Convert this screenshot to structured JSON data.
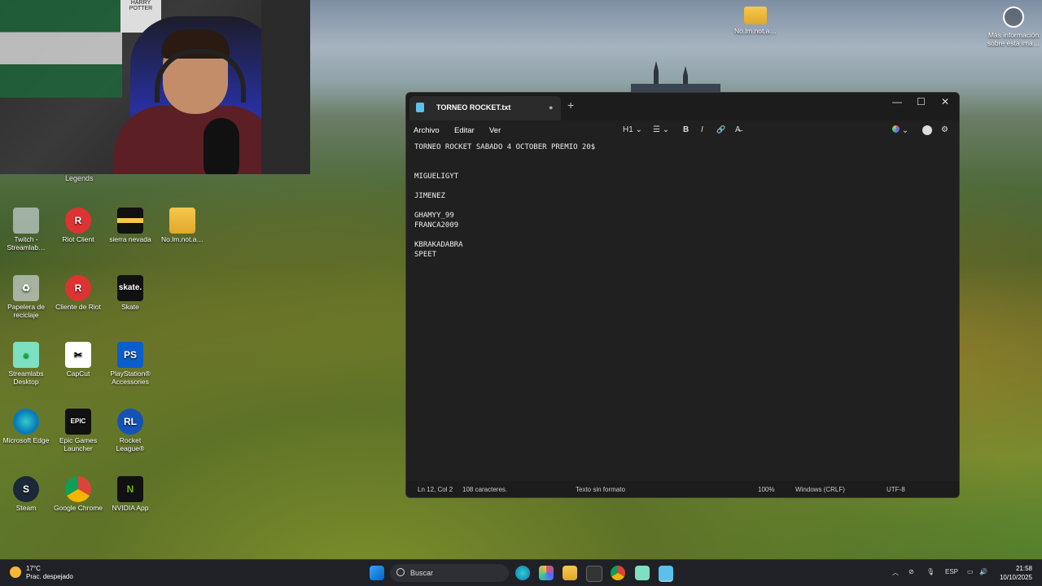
{
  "desktop": {
    "webcam_label": "Legends",
    "poster_text": "HARRY POTTER",
    "icons": [
      {
        "label": "Twitch - Streamlab…",
        "glyph": "",
        "class": "recycle",
        "icon": "twitch-icon"
      },
      {
        "label": "Riot Client",
        "glyph": "R",
        "class": "riot",
        "icon": "riot-client-icon"
      },
      {
        "label": "sierra nevada",
        "glyph": "",
        "class": "blackf",
        "icon": "folder-icon"
      },
      {
        "label": "No.lm.not.a…",
        "glyph": "",
        "class": "folder",
        "icon": "folder-icon"
      },
      {
        "label": "Papelera de reciclaje",
        "glyph": "♻",
        "class": "recycle",
        "icon": "recycle-bin-icon"
      },
      {
        "label": "Cliente de Riot",
        "glyph": "R",
        "class": "riot",
        "icon": "riot-client-icon"
      },
      {
        "label": "Skate",
        "glyph": "skate.",
        "class": "skate",
        "icon": "skate-icon"
      },
      {
        "label": "Streamlabs Desktop",
        "glyph": "●",
        "class": "slabs",
        "icon": "streamlabs-icon"
      },
      {
        "label": "CapCut",
        "glyph": "✂",
        "class": "capcut",
        "icon": "capcut-icon"
      },
      {
        "label": "PlayStation® Accessories",
        "glyph": "PS",
        "class": "ps",
        "icon": "playstation-icon"
      },
      {
        "label": "Microsoft Edge",
        "glyph": "",
        "class": "edge",
        "icon": "edge-icon"
      },
      {
        "label": "Epic Games Launcher",
        "glyph": "EPIC",
        "class": "epic",
        "icon": "epic-games-icon"
      },
      {
        "label": "Rocket League®",
        "glyph": "RL",
        "class": "rl",
        "icon": "rocket-league-icon"
      },
      {
        "label": "Steam",
        "glyph": "S",
        "class": "steam",
        "icon": "steam-icon"
      },
      {
        "label": "Google Chrome",
        "glyph": "",
        "class": "chrome",
        "icon": "chrome-icon"
      },
      {
        "label": "NVIDIA App",
        "glyph": "N",
        "class": "nvidia",
        "icon": "nvidia-icon"
      }
    ],
    "top_folder_label": "No.lm.not.a…",
    "info_label": "Más información sobre esta ima…"
  },
  "notepad": {
    "tab_title": "TORNEO ROCKET.txt",
    "tab_unsaved_dot": "●",
    "new_tab": "+",
    "menus": [
      "Archivo",
      "Editar",
      "Ver"
    ],
    "toolbar": {
      "heading": "H1",
      "list": "☰",
      "bold": "B",
      "italic": "I",
      "link": "🔗",
      "clear": "A̶"
    },
    "lines": [
      "TORNEO ROCKET SABADO 4 OCTOBER PREMIO 20$",
      "",
      "",
      "MIGUELIGYT",
      "",
      "JIMENEZ",
      "",
      "GHAMYY_99",
      "FRANCA2009",
      "",
      "KBRAKADABRA",
      "SPEET"
    ],
    "status": {
      "position": "Ln 12, Col 2",
      "chars": "108 caracteres.",
      "format": "Texto sin formato",
      "zoom": "100%",
      "line_ending": "Windows (CRLF)",
      "encoding": "UTF-8"
    }
  },
  "taskbar": {
    "temp": "17°C",
    "weather": "Prac. despejado",
    "search_placeholder": "Buscar",
    "lang": "ESP",
    "time": "21:58",
    "date": "10/10/2025"
  },
  "colors": {
    "accent": "#5bc0eb",
    "window_bg": "#202020",
    "taskbar_bg": "#1f2126"
  }
}
